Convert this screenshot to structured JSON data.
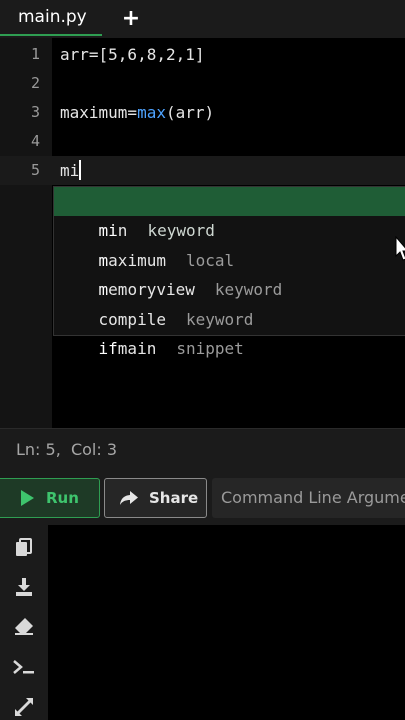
{
  "tab": {
    "title": "main.py",
    "add_label": "+"
  },
  "editor": {
    "lines": [
      {
        "num": "1",
        "code": "arr=[5,6,8,2,1]"
      },
      {
        "num": "2",
        "code": ""
      },
      {
        "num": "3",
        "code_prefix": "maximum=",
        "code_func": "max",
        "code_suffix": "(arr)"
      },
      {
        "num": "4",
        "code": ""
      },
      {
        "num": "5",
        "code": "mi"
      }
    ]
  },
  "autocomplete": {
    "items": [
      {
        "prefix": "mi",
        "rest": "n",
        "kind": "keyword",
        "selected": true
      },
      {
        "prefix": "m",
        "rest": "aximum",
        "kind": "local",
        "selected": false
      },
      {
        "prefix": "m",
        "rest": "emoryview",
        "kind": "keyword",
        "selected": false
      },
      {
        "prefix": "",
        "rest": "compile",
        "kind": "keyword",
        "selected": false
      },
      {
        "prefix": "if",
        "rest": "main",
        "kind": "snippet",
        "selected": false
      }
    ]
  },
  "status": {
    "position": "Ln: 5,  Col: 3"
  },
  "toolbar": {
    "run_label": "Run",
    "share_label": "Share",
    "args_placeholder": "Command Line Arguments"
  },
  "colors": {
    "accent_green": "#2f9e52",
    "keyword_blue": "#4ea3ff",
    "selected_suggestion": "#1f5d36"
  },
  "side_icons": [
    "copy-icon",
    "download-icon",
    "eraser-icon",
    "terminal-icon",
    "expand-icon"
  ]
}
